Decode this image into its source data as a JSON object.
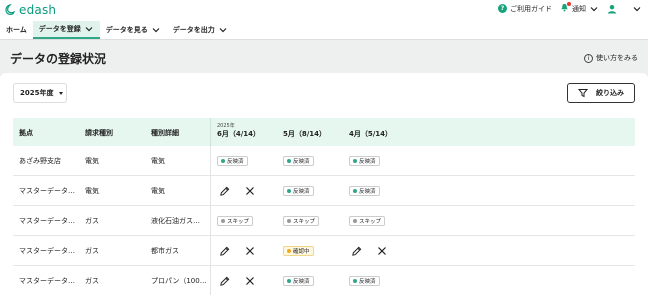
{
  "app": {
    "logo_text": "edash"
  },
  "topbar": {
    "guide_label": "ご利用ガイド",
    "notify_label": "通知"
  },
  "nav": {
    "items": [
      {
        "label": "ホーム",
        "active": false
      },
      {
        "label": "データを登録",
        "active": true
      },
      {
        "label": "データを見る",
        "active": false
      },
      {
        "label": "データを出力",
        "active": false
      }
    ]
  },
  "page": {
    "title": "データの登録状況",
    "howto_label": "使い方をみる",
    "year_select": "2025年度",
    "filter_label": "絞り込み"
  },
  "table": {
    "headers": {
      "site": "拠点",
      "type": "請求種別",
      "detail": "種別詳細",
      "year": "2025年",
      "month1": "6月（4/14）",
      "month2": "5月（8/14）",
      "month3": "4月（5/14）"
    },
    "rows": [
      {
        "site": "あざみ野支店",
        "type": "電気",
        "detail": "電気",
        "m1": {
          "kind": "ok",
          "label": "反映済"
        },
        "m2": {
          "kind": "ok",
          "label": "反映済"
        },
        "m3": {
          "kind": "ok",
          "label": "反映済"
        }
      },
      {
        "site": "マスターデータ…",
        "type": "電気",
        "detail": "電気",
        "m1": {
          "kind": "actions"
        },
        "m2": {
          "kind": "ok",
          "label": "反映済"
        },
        "m3": {
          "kind": "ok",
          "label": "反映済"
        }
      },
      {
        "site": "マスターデータ…",
        "type": "ガス",
        "detail": "液化石油ガス…",
        "m1": {
          "kind": "skip",
          "label": "スキップ"
        },
        "m2": {
          "kind": "skip",
          "label": "スキップ"
        },
        "m3": {
          "kind": "skip",
          "label": "スキップ"
        }
      },
      {
        "site": "マスターデータ…",
        "type": "ガス",
        "detail": "都市ガス",
        "m1": {
          "kind": "actions"
        },
        "m2": {
          "kind": "check",
          "label": "確認中"
        },
        "m3": {
          "kind": "actions"
        }
      },
      {
        "site": "マスターデータ…",
        "type": "ガス",
        "detail": "プロパン（100…",
        "m1": {
          "kind": "actions"
        },
        "m2": {
          "kind": "ok",
          "label": "反映済"
        },
        "m3": {
          "kind": "ok",
          "label": "反映済"
        }
      }
    ]
  },
  "colors": {
    "accent": "#2fa88a",
    "header_bg": "#e6f7f0",
    "check": "#f5a623",
    "skip": "#999999"
  },
  "icons": [
    "logo-icon",
    "help-icon",
    "bell-icon",
    "user-icon",
    "chevron-down-icon",
    "info-icon",
    "filter-icon",
    "edit-icon",
    "close-icon"
  ]
}
